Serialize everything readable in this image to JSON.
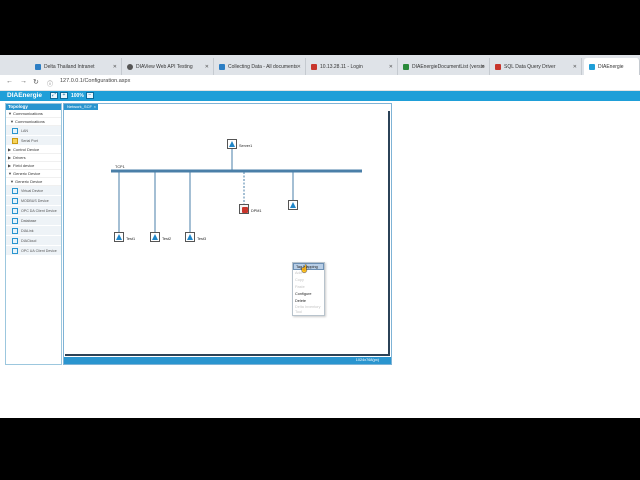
{
  "browser": {
    "tabs": [
      {
        "label": "Delta Thailand Intranet",
        "color": "#2c7ec4"
      },
      {
        "label": "DIAView Web API Testing",
        "color": "#555555"
      },
      {
        "label": "Collecting Data - All documents",
        "color": "#2c7ec4"
      },
      {
        "label": "10.13.28.11 - Login",
        "color": "#c8352c"
      },
      {
        "label": "DIAEnergieDocumentList (versio",
        "color": "#2a8a3a"
      },
      {
        "label": "SQL Data Query Driver",
        "color": "#c8352c"
      },
      {
        "label": "DIAEnergie",
        "color": "#1f9fd8"
      }
    ],
    "url": "127.0.0.1/Configuration.aspx"
  },
  "app": {
    "name": "DIAEnergie",
    "zoom": "100%"
  },
  "sidebar": {
    "title": "Topology",
    "sections": [
      {
        "label": "Communications"
      },
      {
        "label": "Communications"
      },
      {
        "label": "Control Device"
      },
      {
        "label": "Drivers"
      },
      {
        "label": "Field device"
      },
      {
        "label": "Generic Device"
      },
      {
        "label": "Generic Device"
      }
    ],
    "comm_items": [
      {
        "label": "LAN"
      },
      {
        "label": "Serial Port"
      }
    ],
    "generic_items": [
      {
        "label": "Virtual Device"
      },
      {
        "label": "MODBUS Device"
      },
      {
        "label": "OPC DA Client Device"
      },
      {
        "label": "Database"
      },
      {
        "label": "DIALink"
      },
      {
        "label": "DIACloud"
      },
      {
        "label": "OPC UA Client Device"
      }
    ]
  },
  "document": {
    "tab_label": "Network_SCF",
    "resolution": "1024x768(px)"
  },
  "diagram": {
    "bus_label": "TCP1",
    "server_label": "Server1",
    "nodes": [
      {
        "label": "Test1"
      },
      {
        "label": "Test2"
      },
      {
        "label": "Test3"
      },
      {
        "label": "DPM1"
      }
    ]
  },
  "context_menu": {
    "items": [
      {
        "label": "Tag Mapping",
        "state": "highlighted"
      },
      {
        "label": "Add",
        "state": "disabled"
      },
      {
        "label": "Copy",
        "state": "disabled"
      },
      {
        "label": "Paste",
        "state": "disabled"
      },
      {
        "label": "Configure",
        "state": "enabled"
      },
      {
        "label": "Delete",
        "state": "enabled"
      },
      {
        "label": "Delta Inventory Tool",
        "state": "disabled"
      }
    ]
  }
}
